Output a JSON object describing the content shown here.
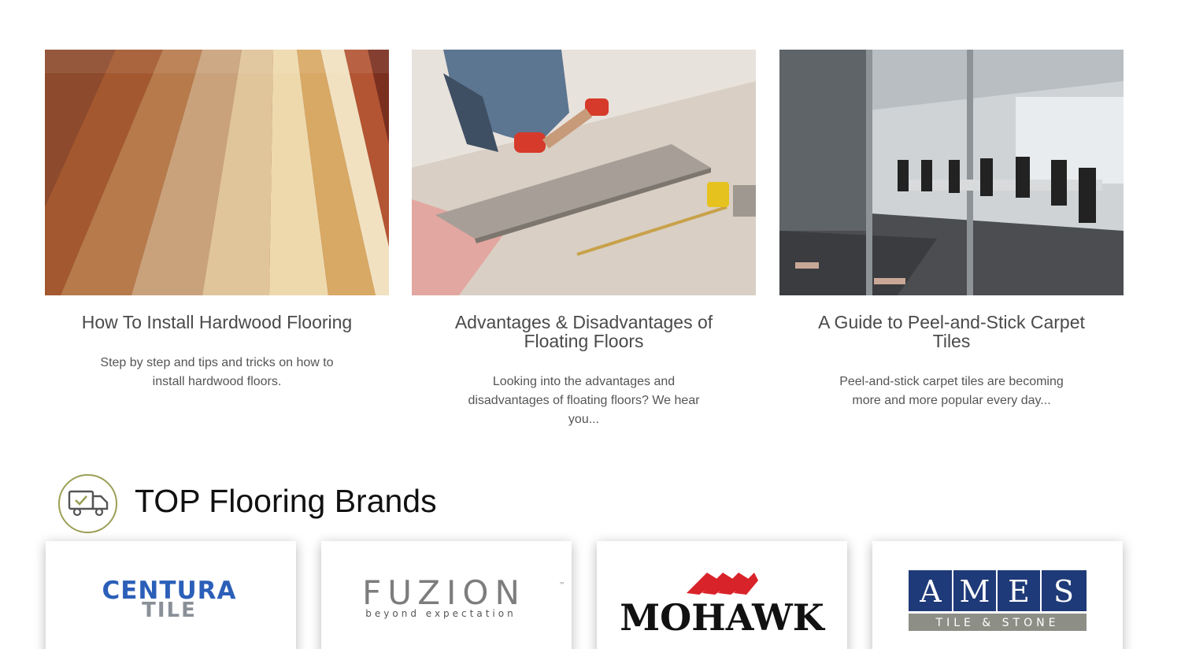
{
  "articles": [
    {
      "title": "How To Install Hardwood Flooring",
      "description": "Step by step and tips and tricks on how to install hardwood floors."
    },
    {
      "title": "Advantages & Disadvantages of Floating Floors",
      "description": "Looking into the advantages and disadvantages of floating floors? We hear you..."
    },
    {
      "title": "A Guide to Peel-and-Stick Carpet Tiles",
      "description": "Peel-and-stick carpet tiles are becoming more and more popular every day..."
    }
  ],
  "brands_section": {
    "title": "TOP Flooring Brands",
    "icon": "delivery-truck-icon"
  },
  "brands": [
    {
      "name": "CENTURA TILE",
      "line1": "CENTURA",
      "line2": "TILE"
    },
    {
      "name": "FUZION",
      "line1": "FUZION",
      "tagline": "beyond expectation",
      "mark": "™"
    },
    {
      "name": "MOHAWK",
      "line1": "MOHAWK"
    },
    {
      "name": "AMES TILE & STONE",
      "letters": [
        "A",
        "M",
        "E",
        "S"
      ],
      "line2": "TILE & STONE"
    }
  ],
  "colors": {
    "page_bg": "#ffffff",
    "title_text": "#4a4a4a",
    "body_text": "#555555",
    "icon_ring": "#9aa055",
    "centura_blue": "#2b5fb8",
    "centura_grey": "#8a9098",
    "mohawk_red": "#d9232a",
    "ames_navy": "#1f3a78",
    "ames_band": "#8d8f86"
  }
}
